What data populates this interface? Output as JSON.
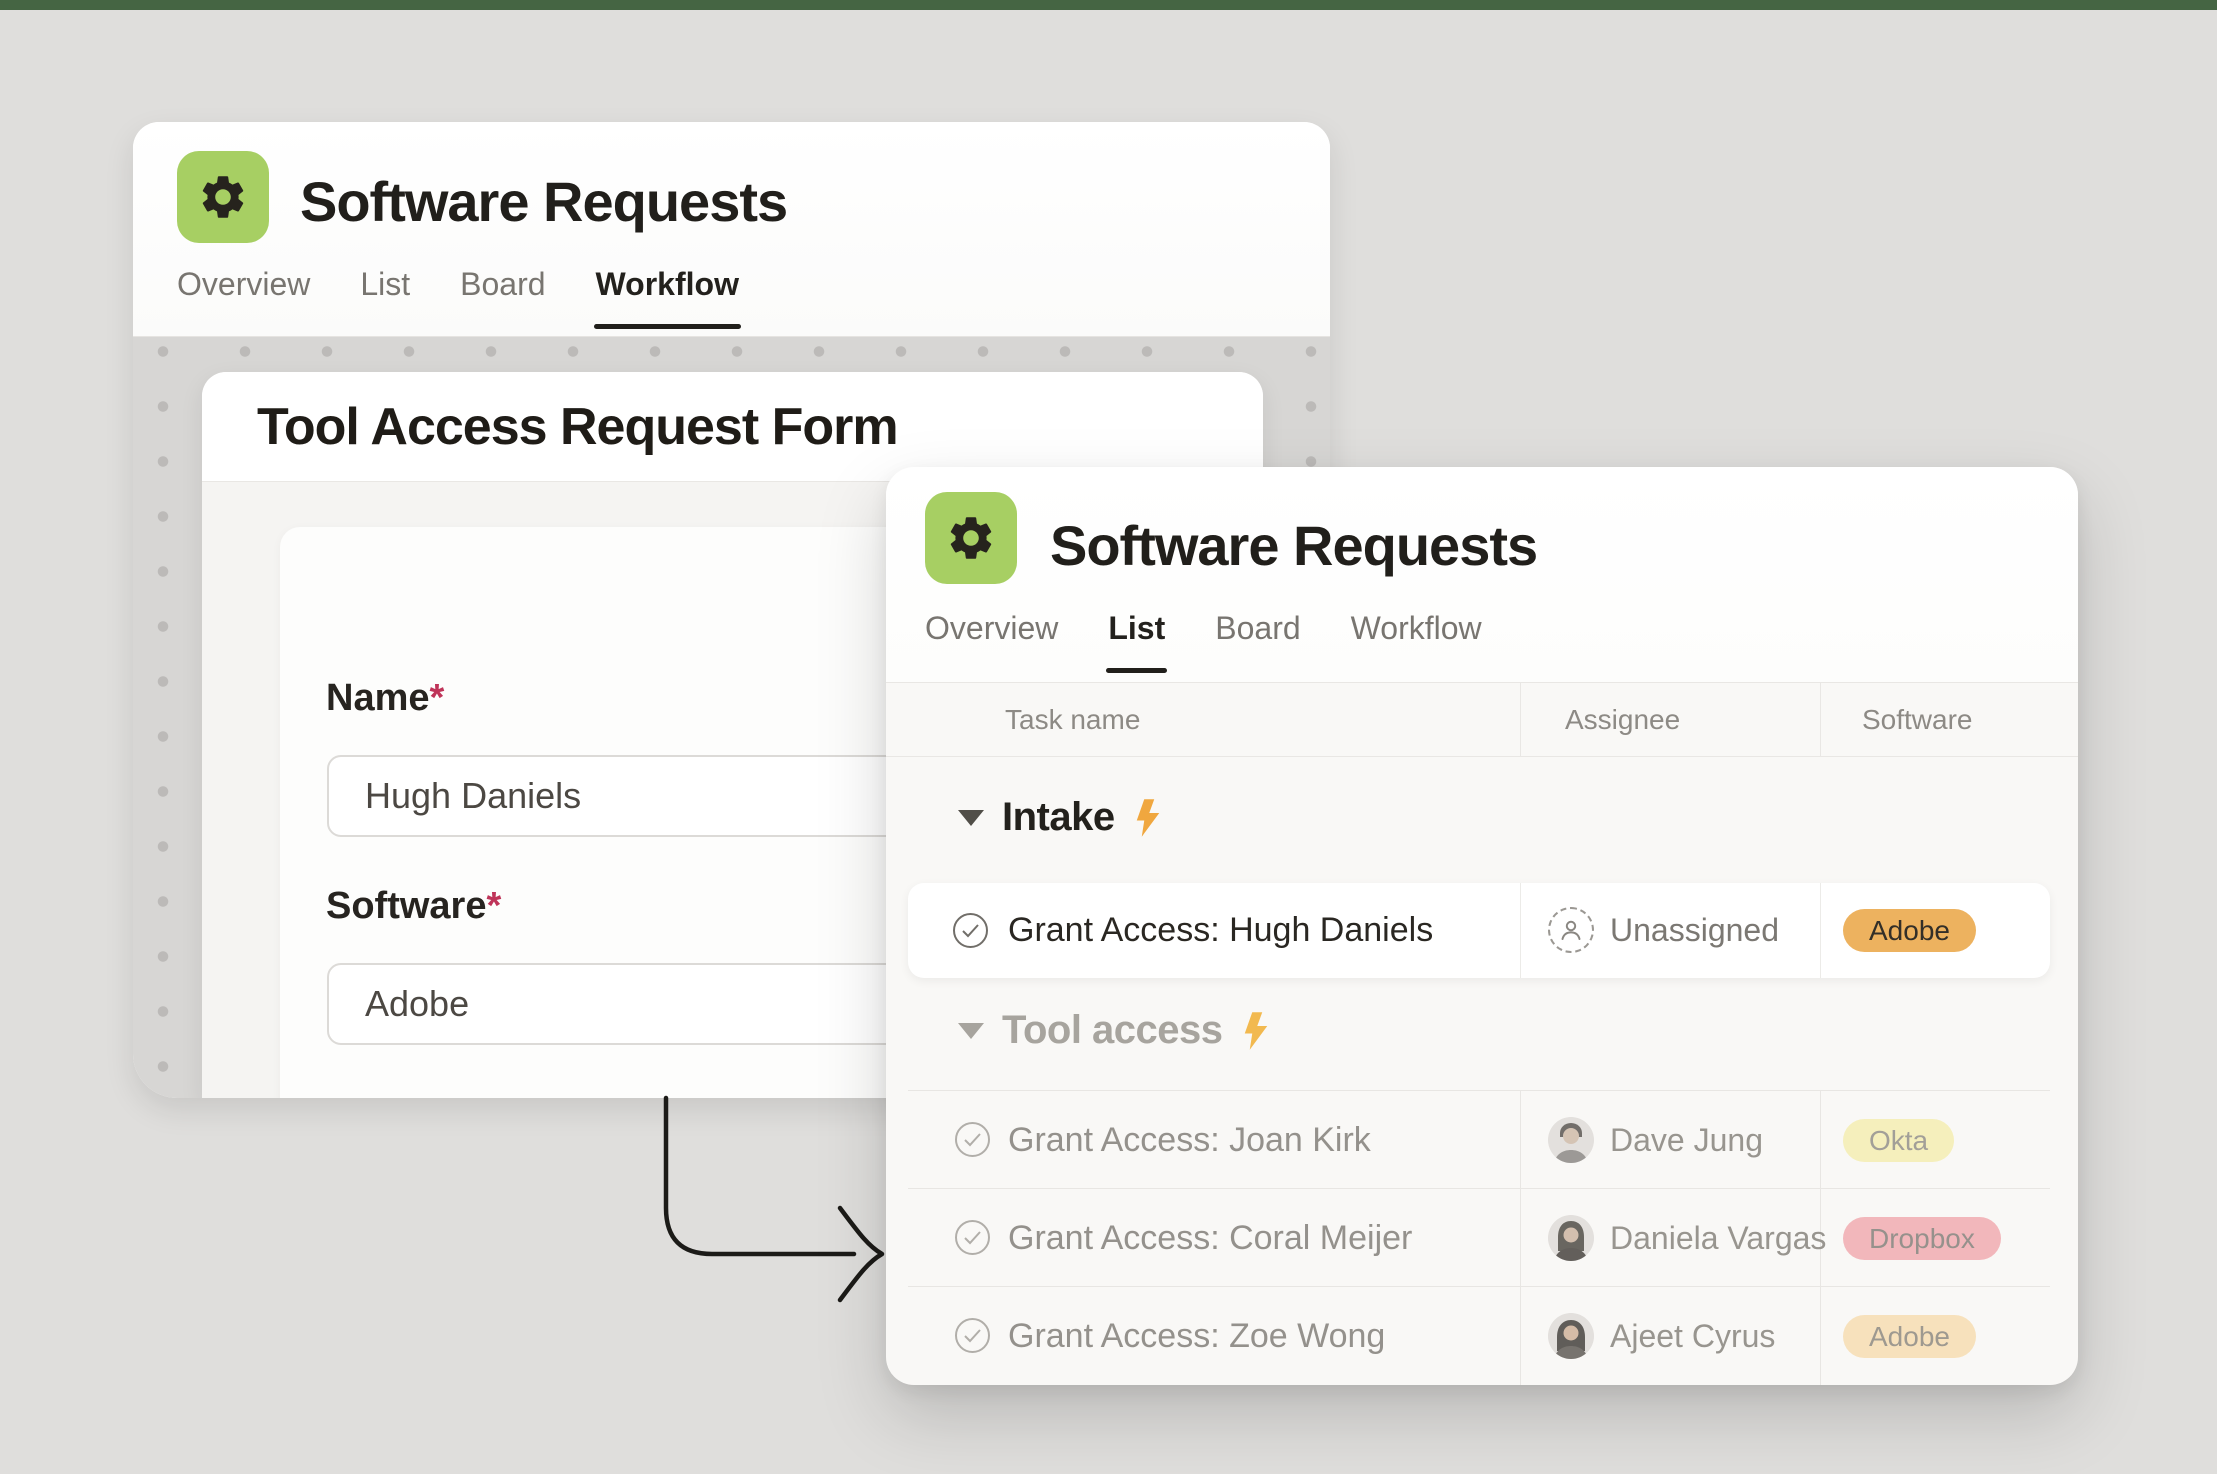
{
  "page": {
    "top_bar_color": "#456543",
    "background_color": "#dfdedc",
    "arrow_color": "#1c1b18"
  },
  "app": {
    "icon": "gear-icon",
    "icon_bg": "#a7cf63"
  },
  "workflow_card": {
    "title": "Software Requests",
    "tabs": [
      {
        "label": "Overview",
        "active": false
      },
      {
        "label": "List",
        "active": false
      },
      {
        "label": "Board",
        "active": false
      },
      {
        "label": "Workflow",
        "active": true
      }
    ],
    "form": {
      "title": "Tool Access Request Form",
      "fields": [
        {
          "label": "Name",
          "required_mark": "*",
          "value": "Hugh Daniels"
        },
        {
          "label": "Software",
          "required_mark": "*",
          "value": "Adobe"
        }
      ]
    }
  },
  "list_card": {
    "title": "Software Requests",
    "tabs": [
      {
        "label": "Overview",
        "active": false
      },
      {
        "label": "List",
        "active": true
      },
      {
        "label": "Board",
        "active": false
      },
      {
        "label": "Workflow",
        "active": false
      }
    ],
    "table": {
      "columns": [
        "Task name",
        "Assignee",
        "Software"
      ]
    },
    "sections": [
      {
        "name": "Intake",
        "bolt_color": "#f0a73f",
        "caret_color": "#514e48",
        "rows": [
          {
            "task": "Grant Access: Hugh Daniels",
            "assignee": "Unassigned",
            "software": "Adobe",
            "badge_bg": "#edb25f",
            "badge_fg": "#332f28"
          }
        ]
      },
      {
        "name": "Tool access",
        "bolt_color": "#f2b94f",
        "caret_color": "#a7a49e",
        "rows": [
          {
            "task": "Grant Access: Joan Kirk",
            "assignee": "Dave Jung",
            "software": "Okta",
            "badge_bg": "#f5efbc",
            "badge_fg": "#a29f98"
          },
          {
            "task": "Grant Access: Coral Meijer",
            "assignee": "Daniela Vargas",
            "software": "Dropbox",
            "badge_bg": "#f2b7bb",
            "badge_fg": "#96918c"
          },
          {
            "task": "Grant Access: Zoe Wong",
            "assignee": "Ajeet Cyrus",
            "software": "Adobe",
            "badge_bg": "#f7e1bc",
            "badge_fg": "#9e9990"
          }
        ]
      }
    ]
  }
}
